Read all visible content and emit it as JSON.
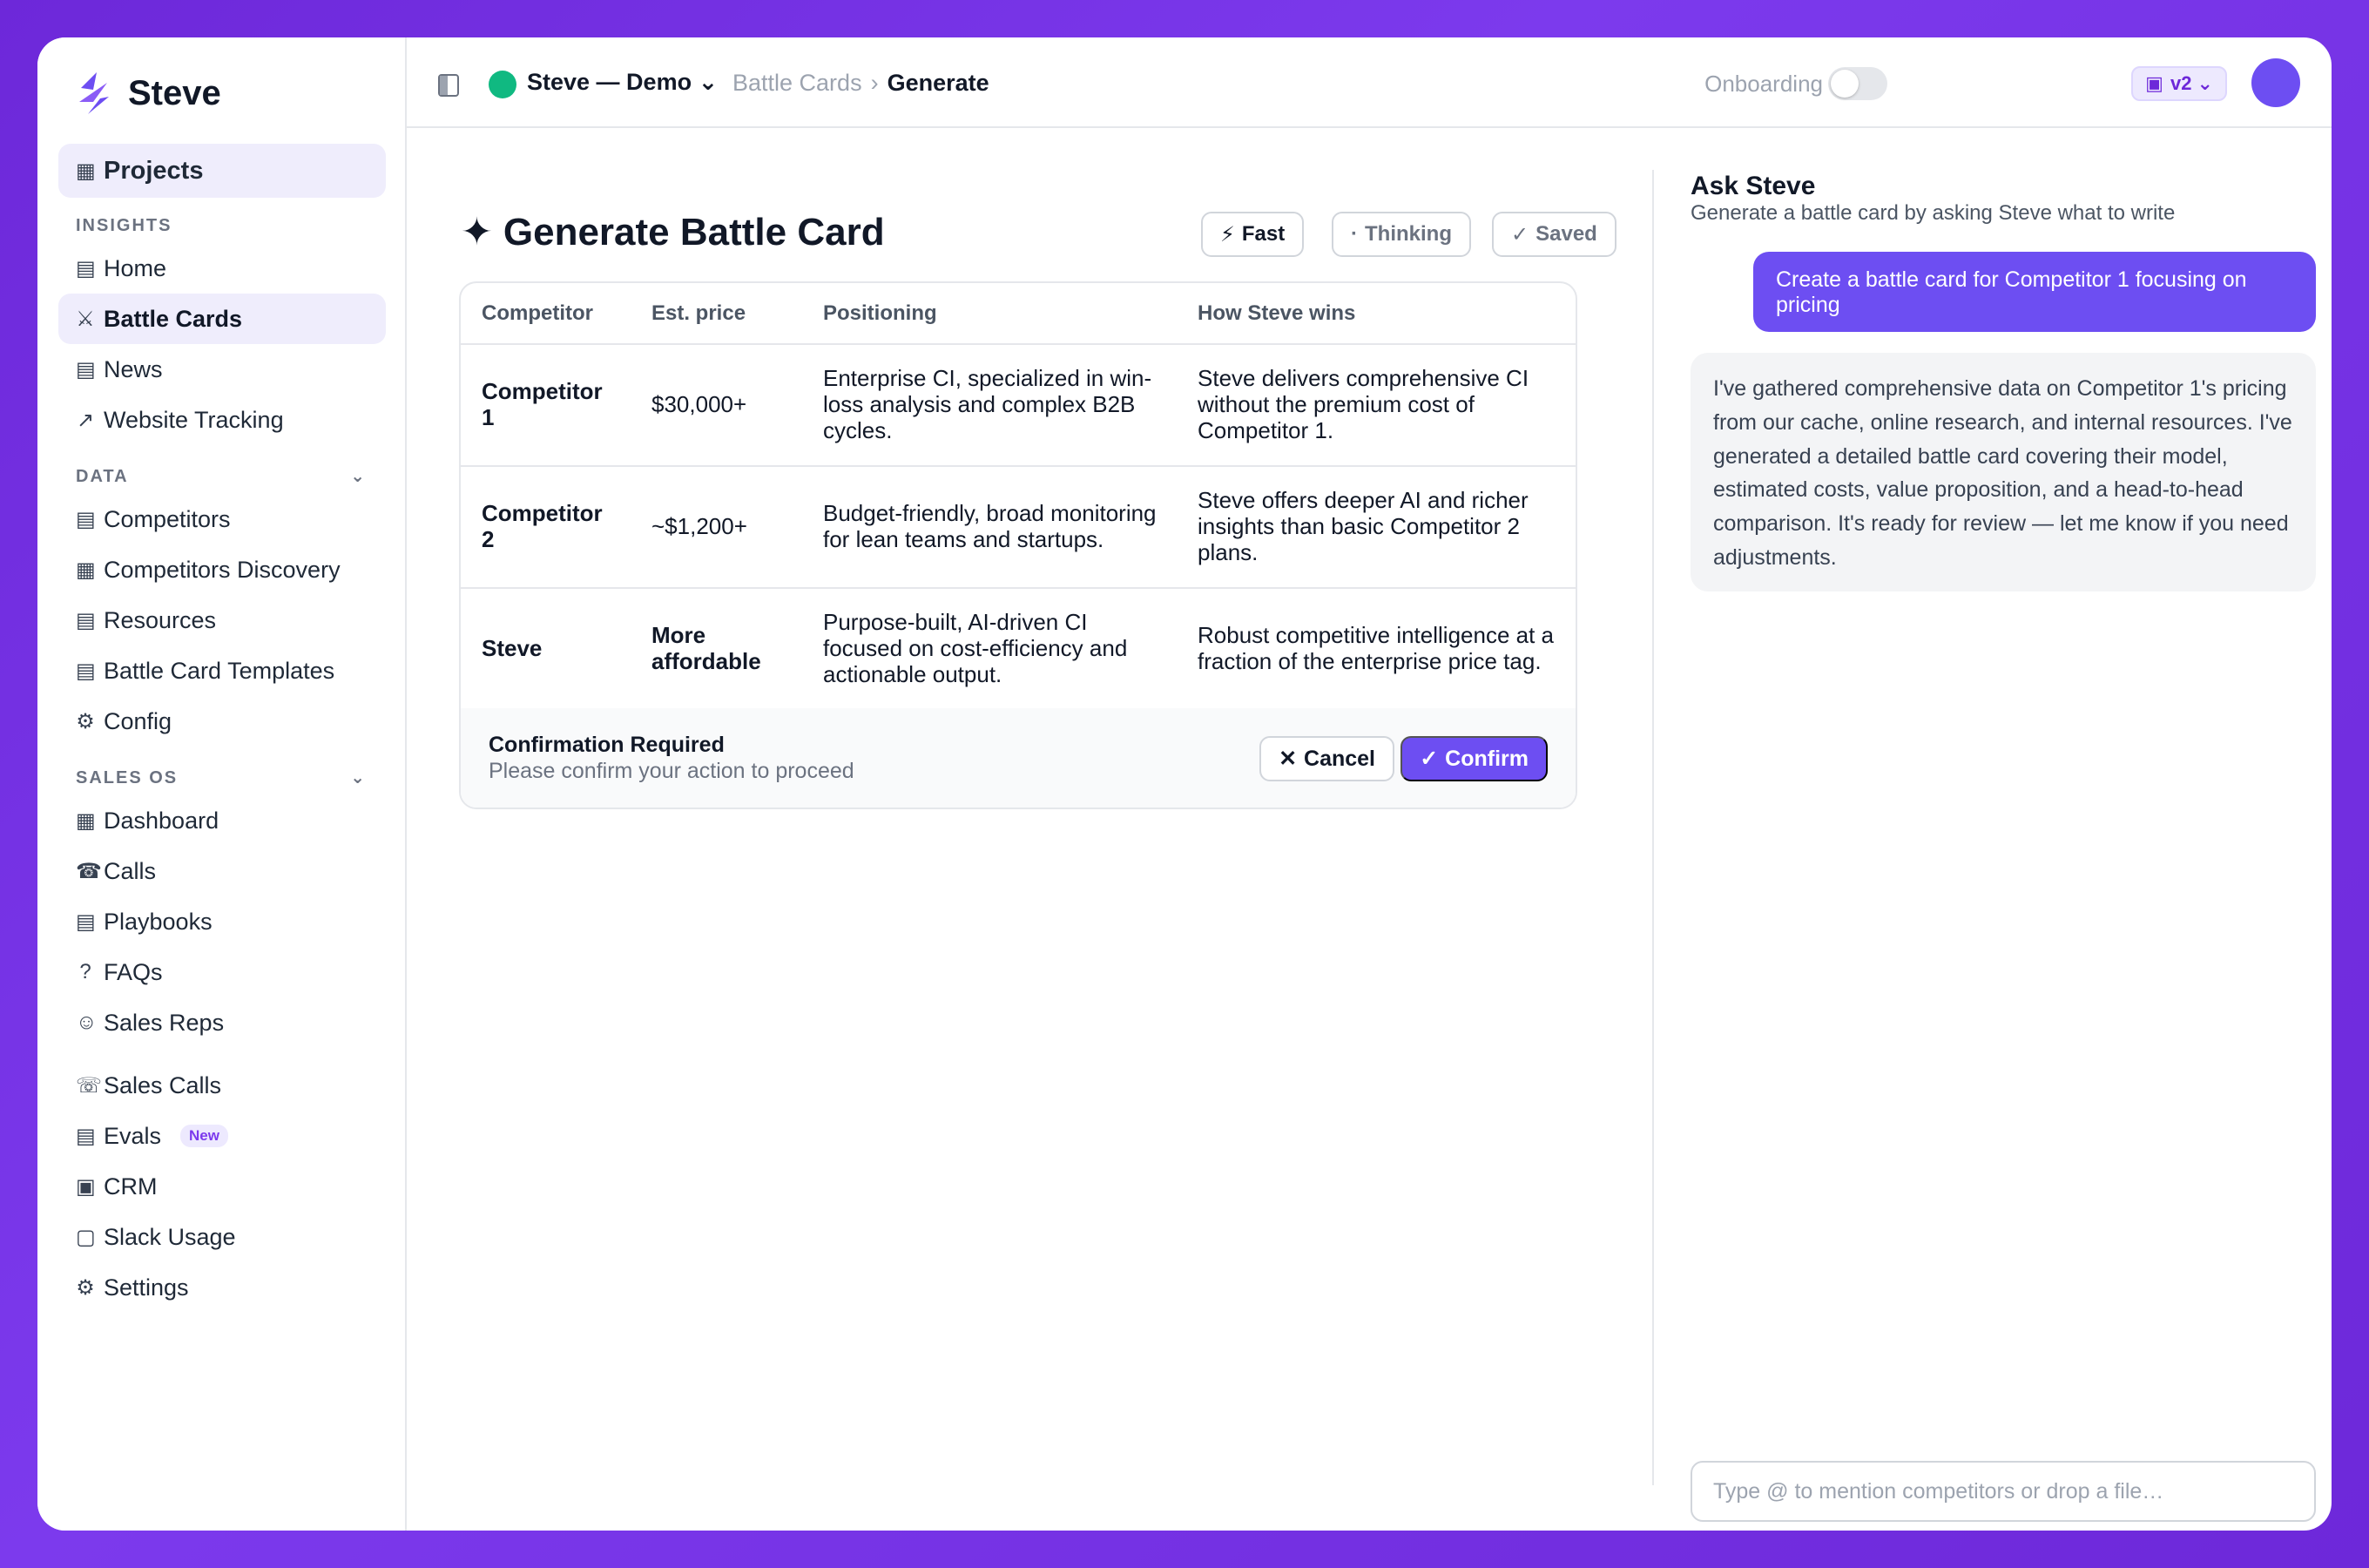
{
  "brand": {
    "name": "Steve"
  },
  "sidebar": {
    "projects": {
      "icon": "▦",
      "label": "Projects"
    },
    "sections": {
      "insights": "INSIGHTS",
      "data": "DATA",
      "sales_os": "SALES OS"
    },
    "insights_items": [
      {
        "icon": "▤",
        "label": "Home"
      },
      {
        "icon": "⚔",
        "label": "Battle Cards"
      },
      {
        "icon": "▤",
        "label": "News"
      },
      {
        "icon": "↗",
        "label": "Website Tracking"
      }
    ],
    "data_items": [
      {
        "icon": "▤",
        "label": "Competitors"
      },
      {
        "icon": "▦",
        "label": "Competitors Discovery"
      },
      {
        "icon": "▤",
        "label": "Resources"
      },
      {
        "icon": "▤",
        "label": "Battle Card Templates"
      },
      {
        "icon": "⚙",
        "label": "Config"
      }
    ],
    "sales_items": [
      {
        "icon": "▦",
        "label": "Dashboard"
      },
      {
        "icon": "☎",
        "label": "Calls"
      },
      {
        "icon": "▤",
        "label": "Playbooks"
      },
      {
        "icon": "?",
        "label": "FAQs"
      },
      {
        "icon": "☺",
        "label": "Sales Reps"
      }
    ],
    "extra_items": [
      {
        "icon": "☏",
        "label": "Sales Calls"
      },
      {
        "icon": "▤",
        "label": "Evals",
        "badge": "New"
      },
      {
        "icon": "▣",
        "label": "CRM"
      },
      {
        "icon": "▢",
        "label": "Slack Usage"
      },
      {
        "icon": "⚙",
        "label": "Settings"
      }
    ]
  },
  "topbar": {
    "project": "Steve — Demo ⌄",
    "breadcrumb_parent": "Battle Cards",
    "breadcrumb_sep": "›",
    "breadcrumb_current": "Generate",
    "onboarding_label": "Onboarding",
    "version_icon": "▣",
    "version": "v2 ⌄"
  },
  "main": {
    "title_icon": "✦",
    "title": "Generate Battle Card",
    "chips": {
      "fast_icon": "⚡",
      "fast": "Fast",
      "thinking_icon": "·",
      "thinking": "Thinking",
      "saved_icon": "✓",
      "saved": "Saved"
    },
    "table": {
      "headers": [
        "Competitor",
        "Est. price",
        "Positioning",
        "How Steve wins"
      ],
      "rows": [
        [
          "Competitor 1",
          "$30,000+",
          "Enterprise CI, specialized in win-loss analysis and complex B2B cycles.",
          "Steve delivers comprehensive CI without the premium cost of Competitor 1."
        ],
        [
          "Competitor 2",
          "~$1,200+",
          "Budget-friendly, broad monitoring for lean teams and startups.",
          "Steve offers deeper AI and richer insights than basic Competitor 2 plans."
        ],
        [
          "Steve",
          "More affordable",
          "Purpose-built, AI-driven CI focused on cost-efficiency and actionable output.",
          "Robust competitive intelligence at a fraction of the enterprise price tag."
        ]
      ]
    },
    "confirmation": {
      "title": "Confirmation Required",
      "subtitle": "Please confirm your action to proceed",
      "cancel_icon": "✕",
      "cancel": "Cancel",
      "confirm_icon": "✓",
      "confirm": "Confirm"
    }
  },
  "chat": {
    "title": "Ask Steve",
    "subtitle": "Generate a battle card by asking Steve what to write",
    "user_message": "Create a battle card for Competitor 1 focusing on pricing",
    "ai_message": "I've gathered comprehensive data on Competitor 1's pricing from our cache, online research, and internal resources. I've generated a detailed battle card covering their model, estimated costs, value proposition, and a head-to-head comparison. It's ready for review — let me know if you need adjustments.",
    "input_placeholder": "Type @ to mention competitors or drop a file…"
  },
  "colors": {
    "accent": "#6d4ef2",
    "status_dot": "#10b981",
    "background": "#7c3aed"
  }
}
